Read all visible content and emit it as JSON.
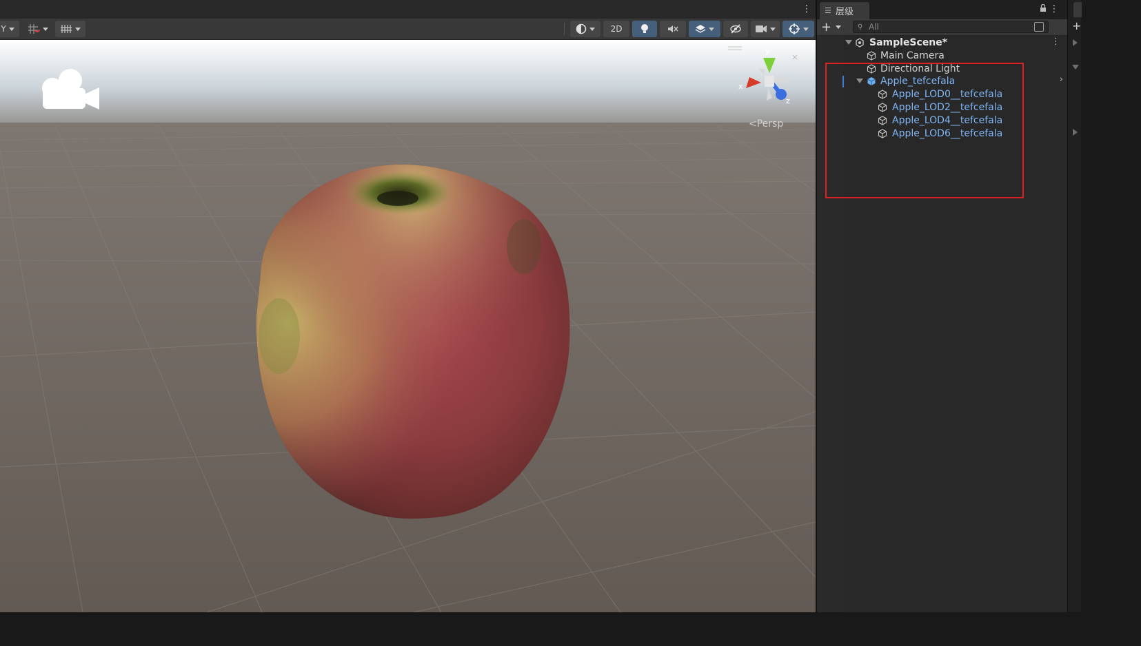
{
  "scene_view": {
    "toolbar": {
      "mode_2d_label": "2D"
    },
    "persp_label": "Persp",
    "gizmo_axes": {
      "x": "x",
      "y": "y",
      "z": "z"
    }
  },
  "hierarchy": {
    "tab_label": "层级",
    "search_placeholder": "All",
    "scene": {
      "label": "SampleScene*"
    },
    "items": [
      {
        "label": "Main Camera"
      },
      {
        "label": "Directional Light"
      },
      {
        "label": "Apple_tefcefala"
      },
      {
        "label": "Apple_LOD0__tefcefala"
      },
      {
        "label": "Apple_LOD2__tefcefala"
      },
      {
        "label": "Apple_LOD4__tefcefala"
      },
      {
        "label": "Apple_LOD6__tefcefala"
      }
    ]
  },
  "colors": {
    "prefab_text": "#7fb5f5",
    "highlight_box": "#e02020",
    "active_toggle": "#46607c"
  }
}
